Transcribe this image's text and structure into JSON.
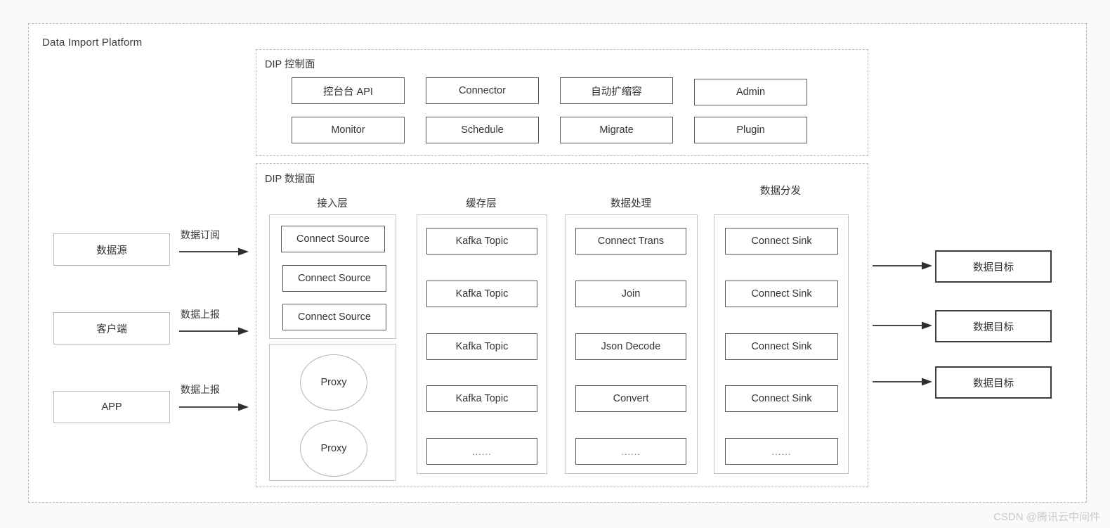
{
  "platform": {
    "title": "Data Import Platform",
    "watermark": "CSDN @腾讯云中间件"
  },
  "control_plane": {
    "title": "DIP 控制面",
    "rows": [
      [
        {
          "label": "控台台 API"
        },
        {
          "label": "Connector"
        },
        {
          "label": "自动扩缩容"
        },
        {
          "label": "Admin"
        }
      ],
      [
        {
          "label": "Monitor"
        },
        {
          "label": "Schedule"
        },
        {
          "label": "Migrate"
        },
        {
          "label": "Plugin"
        }
      ]
    ]
  },
  "data_plane": {
    "title": "DIP 数据面",
    "columns": [
      {
        "header": "接入层",
        "groups": [
          {
            "items": [
              "Connect Source",
              "Connect Source",
              "Connect Source"
            ]
          },
          {
            "items": [
              "Proxy",
              "Proxy"
            ]
          }
        ]
      },
      {
        "header": "缓存层",
        "groups": [
          {
            "items": [
              "Kafka Topic",
              "Kafka Topic",
              "Kafka Topic",
              "Kafka Topic",
              "......"
            ]
          }
        ]
      },
      {
        "header": "数据处理",
        "groups": [
          {
            "items": [
              "Connect Trans",
              "Join",
              "Json Decode",
              "Convert",
              "......"
            ]
          }
        ]
      },
      {
        "header": "数据分发",
        "groups": [
          {
            "items": [
              "Connect Sink",
              "Connect Sink",
              "Connect Sink",
              "Connect Sink",
              "......"
            ]
          }
        ]
      }
    ]
  },
  "sources": [
    {
      "label": "数据源",
      "arrow_label": "数据订阅"
    },
    {
      "label": "客户端",
      "arrow_label": "数据上报"
    },
    {
      "label": "APP",
      "arrow_label": "数据上报"
    }
  ],
  "targets": [
    {
      "label": "数据目标"
    },
    {
      "label": "数据目标"
    },
    {
      "label": "数据目标"
    }
  ],
  "colors": {
    "background": "#fafafa",
    "panel_border": "#b9b9b9",
    "node_border": "#5b5b5b",
    "group_border": "#c4c4c4",
    "target_border": "#3c3c3c",
    "text": "#333333",
    "watermark": "#c9c9c9"
  }
}
